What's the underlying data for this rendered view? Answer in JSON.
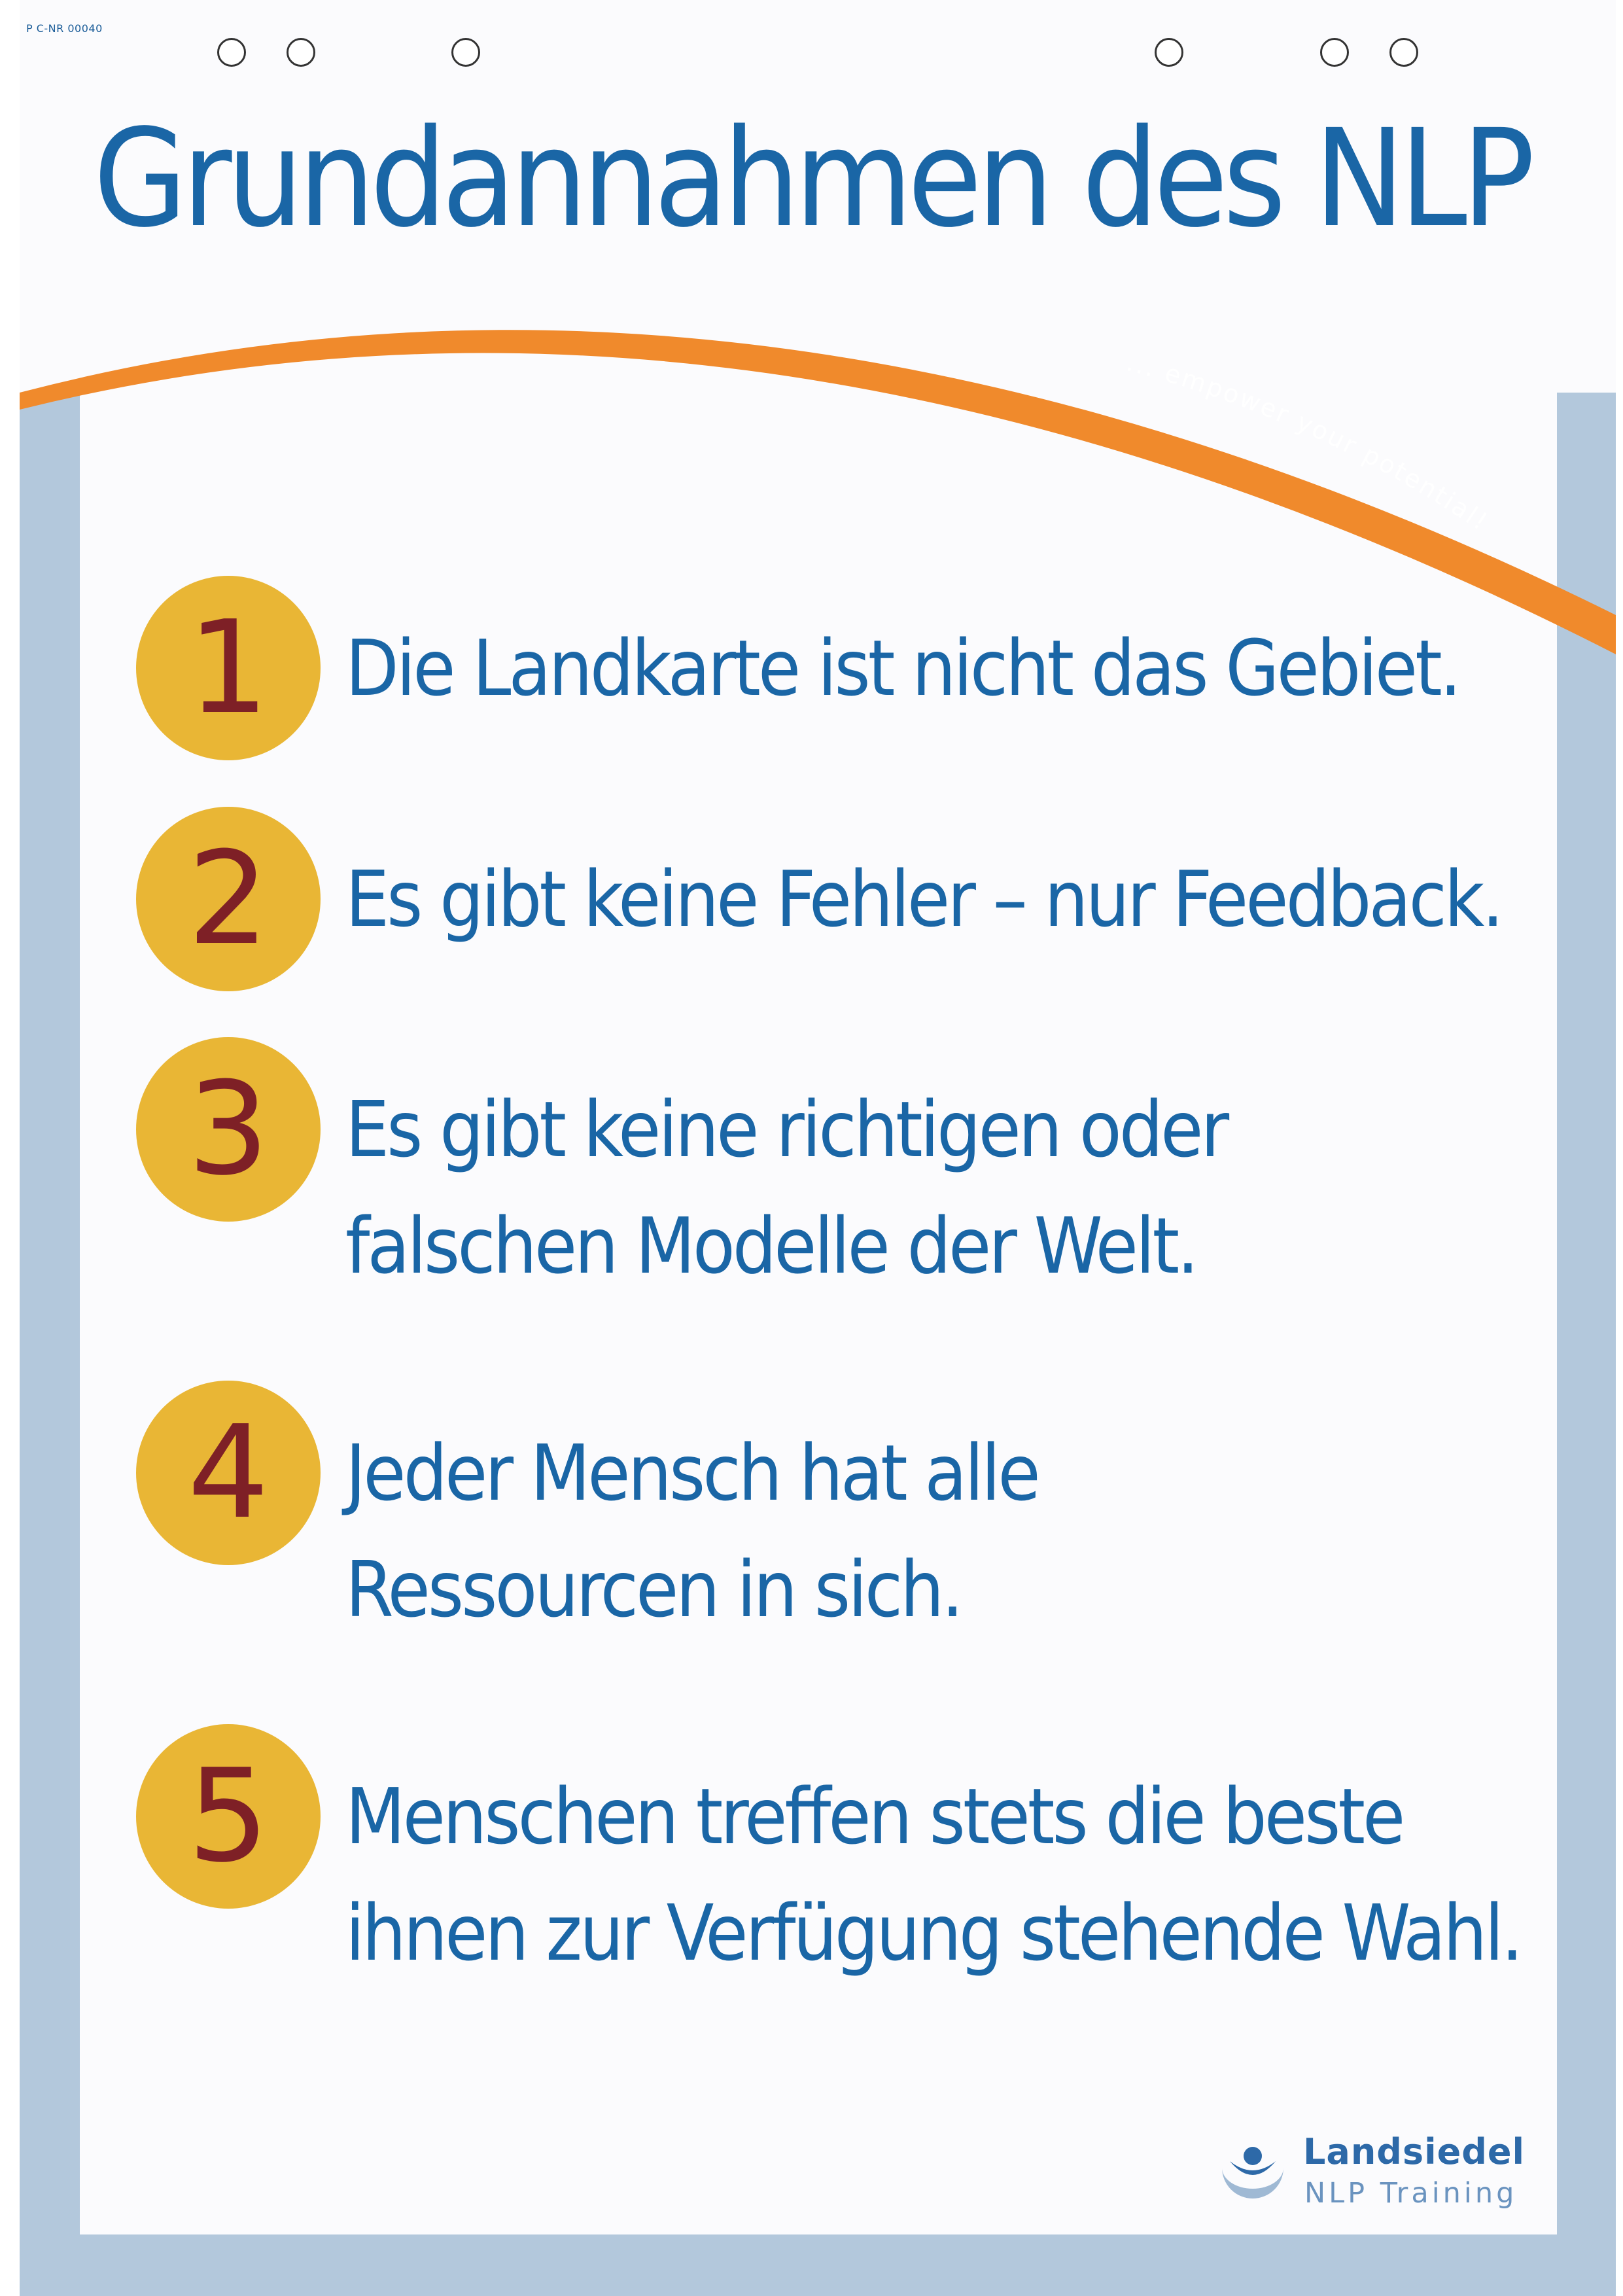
{
  "product_code": "P C-NR 00040",
  "title": "Grundannahmen des NLP",
  "tagline": "... empower your potential!",
  "items": [
    {
      "number": "1",
      "lines": [
        "Die Landkarte ist nicht das Gebiet."
      ]
    },
    {
      "number": "2",
      "lines": [
        "Es gibt keine Fehler – nur Feedback."
      ]
    },
    {
      "number": "3",
      "lines": [
        "Es gibt keine richtigen oder",
        "falschen Modelle der Welt."
      ]
    },
    {
      "number": "4",
      "lines": [
        "Jeder Mensch hat alle",
        "Ressourcen in sich."
      ]
    },
    {
      "number": "5",
      "lines": [
        "Menschen treffen stets die beste",
        "ihnen zur Verfügung stehende Wahl."
      ]
    }
  ],
  "brand": {
    "name": "Landsiedel",
    "subtitle": "NLP Training",
    "logo_icon": "landsiedel-logo-icon"
  },
  "colors": {
    "title_blue": "#1a66a6",
    "frame_blue": "#b3c8dc",
    "swoosh_orange": "#f08a2c",
    "badge_yellow": "#e9b635",
    "number_red": "#7e2026"
  }
}
